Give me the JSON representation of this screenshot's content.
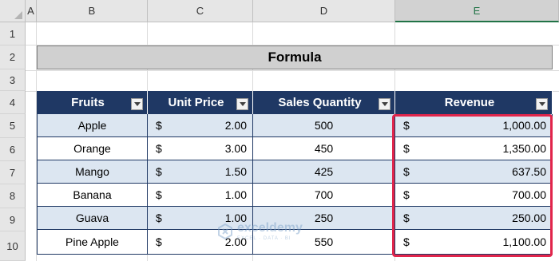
{
  "columns": [
    "A",
    "B",
    "C",
    "D",
    "E"
  ],
  "rows": [
    "1",
    "2",
    "3",
    "4",
    "5",
    "6",
    "7",
    "8",
    "9",
    "10"
  ],
  "title": "Formula",
  "table": {
    "headers": [
      "Fruits",
      "Unit Price",
      "Sales Quantity",
      "Revenue"
    ],
    "currency": "$",
    "rows": [
      {
        "fruit": "Apple",
        "price": "2.00",
        "qty": "500",
        "revenue": "1,000.00"
      },
      {
        "fruit": "Orange",
        "price": "3.00",
        "qty": "450",
        "revenue": "1,350.00"
      },
      {
        "fruit": "Mango",
        "price": "1.50",
        "qty": "425",
        "revenue": "637.50"
      },
      {
        "fruit": "Banana",
        "price": "1.00",
        "qty": "700",
        "revenue": "700.00"
      },
      {
        "fruit": "Guava",
        "price": "1.00",
        "qty": "250",
        "revenue": "250.00"
      },
      {
        "fruit": "Pine Apple",
        "price": "2.00",
        "qty": "550",
        "revenue": "1,100.00"
      }
    ]
  },
  "watermark": {
    "name": "exceldemy",
    "tagline": "EXCEL · DATA · BI"
  },
  "colors": {
    "header_bg": "#1f3864",
    "band_bg": "#dce6f1",
    "highlight": "#e1254b",
    "selected_col": "#217346"
  }
}
